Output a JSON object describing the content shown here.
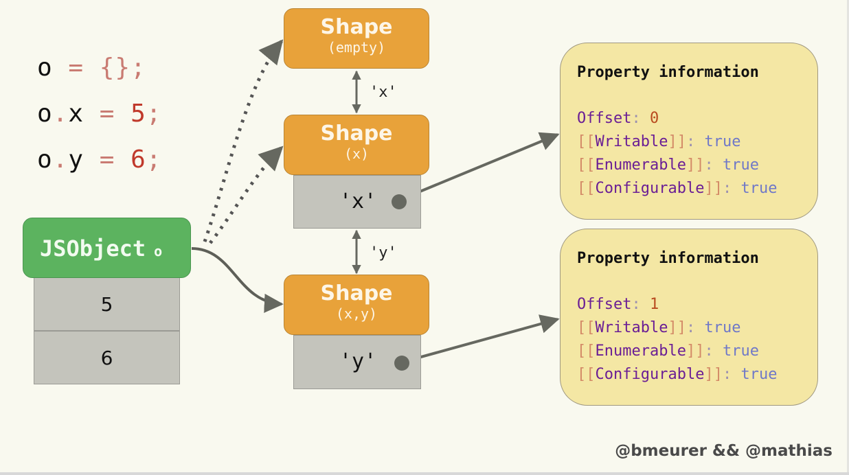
{
  "code_lines": [
    {
      "obj": "o",
      "prop_sep": "",
      "prop": "",
      "eq": "=",
      "value": "{}",
      "semi": ";"
    },
    {
      "obj": "o",
      "prop_sep": ".",
      "prop": "x",
      "eq": "=",
      "value": "5",
      "semi": ";"
    },
    {
      "obj": "o",
      "prop_sep": ".",
      "prop": "y",
      "eq": "=",
      "value": "6",
      "semi": ";"
    }
  ],
  "shapes": [
    {
      "title": "Shape",
      "subtitle": "(empty)"
    },
    {
      "title": "Shape",
      "subtitle": "(x)",
      "key": "'x'"
    },
    {
      "title": "Shape",
      "subtitle": "(x,y)",
      "key": "'y'"
    }
  ],
  "transitions": [
    "'x'",
    "'y'"
  ],
  "jsobject": {
    "label": "JSObject",
    "name": "o",
    "values": [
      "5",
      "6"
    ]
  },
  "property_info": [
    {
      "heading": "Property information",
      "offset_label": "Offset",
      "offset": "0",
      "attrs": [
        {
          "name": "Writable",
          "value": "true"
        },
        {
          "name": "Enumerable",
          "value": "true"
        },
        {
          "name": "Configurable",
          "value": "true"
        }
      ]
    },
    {
      "heading": "Property information",
      "offset_label": "Offset",
      "offset": "1",
      "attrs": [
        {
          "name": "Writable",
          "value": "true"
        },
        {
          "name": "Enumerable",
          "value": "true"
        },
        {
          "name": "Configurable",
          "value": "true"
        }
      ]
    }
  ],
  "credit": "@bmeurer && @mathias",
  "colors": {
    "shape": "#e8a23a",
    "jsobject": "#5cb35f",
    "info": "#f4e7a4",
    "cell": "#c4c4bc",
    "arrow": "#666860",
    "background": "#f9f9ef"
  }
}
